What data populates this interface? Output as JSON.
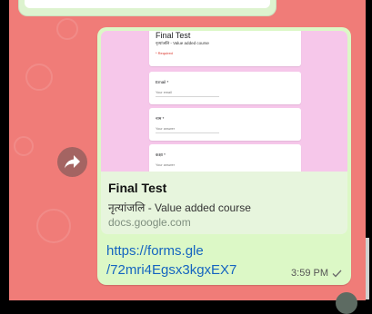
{
  "form": {
    "title": "Final Test",
    "description": "नृत्यांजलि - Value added course",
    "required_note": "* Required",
    "fields": [
      {
        "label": "Email *",
        "placeholder": "Your email"
      },
      {
        "label": "नाम *",
        "placeholder": "Your answer"
      },
      {
        "label": "कक्षा *",
        "placeholder": "Your answer"
      }
    ],
    "partial_field": {
      "placeholder": "Your answer"
    }
  },
  "link_preview": {
    "title": "Final Test",
    "description": "नृत्यांजलि - Value added course",
    "domain": "docs.google.com"
  },
  "message": {
    "url_line1": "https://forms.gle",
    "url_line2": "/72mri4Egsx3kgxEX7",
    "time": "3:59 PM",
    "status_icon": "single-check-icon"
  },
  "colors": {
    "chat_background": "#f07c78",
    "bubble": "#dcf8c6",
    "form_background": "#f6c7ea",
    "link": "#1565c0"
  }
}
